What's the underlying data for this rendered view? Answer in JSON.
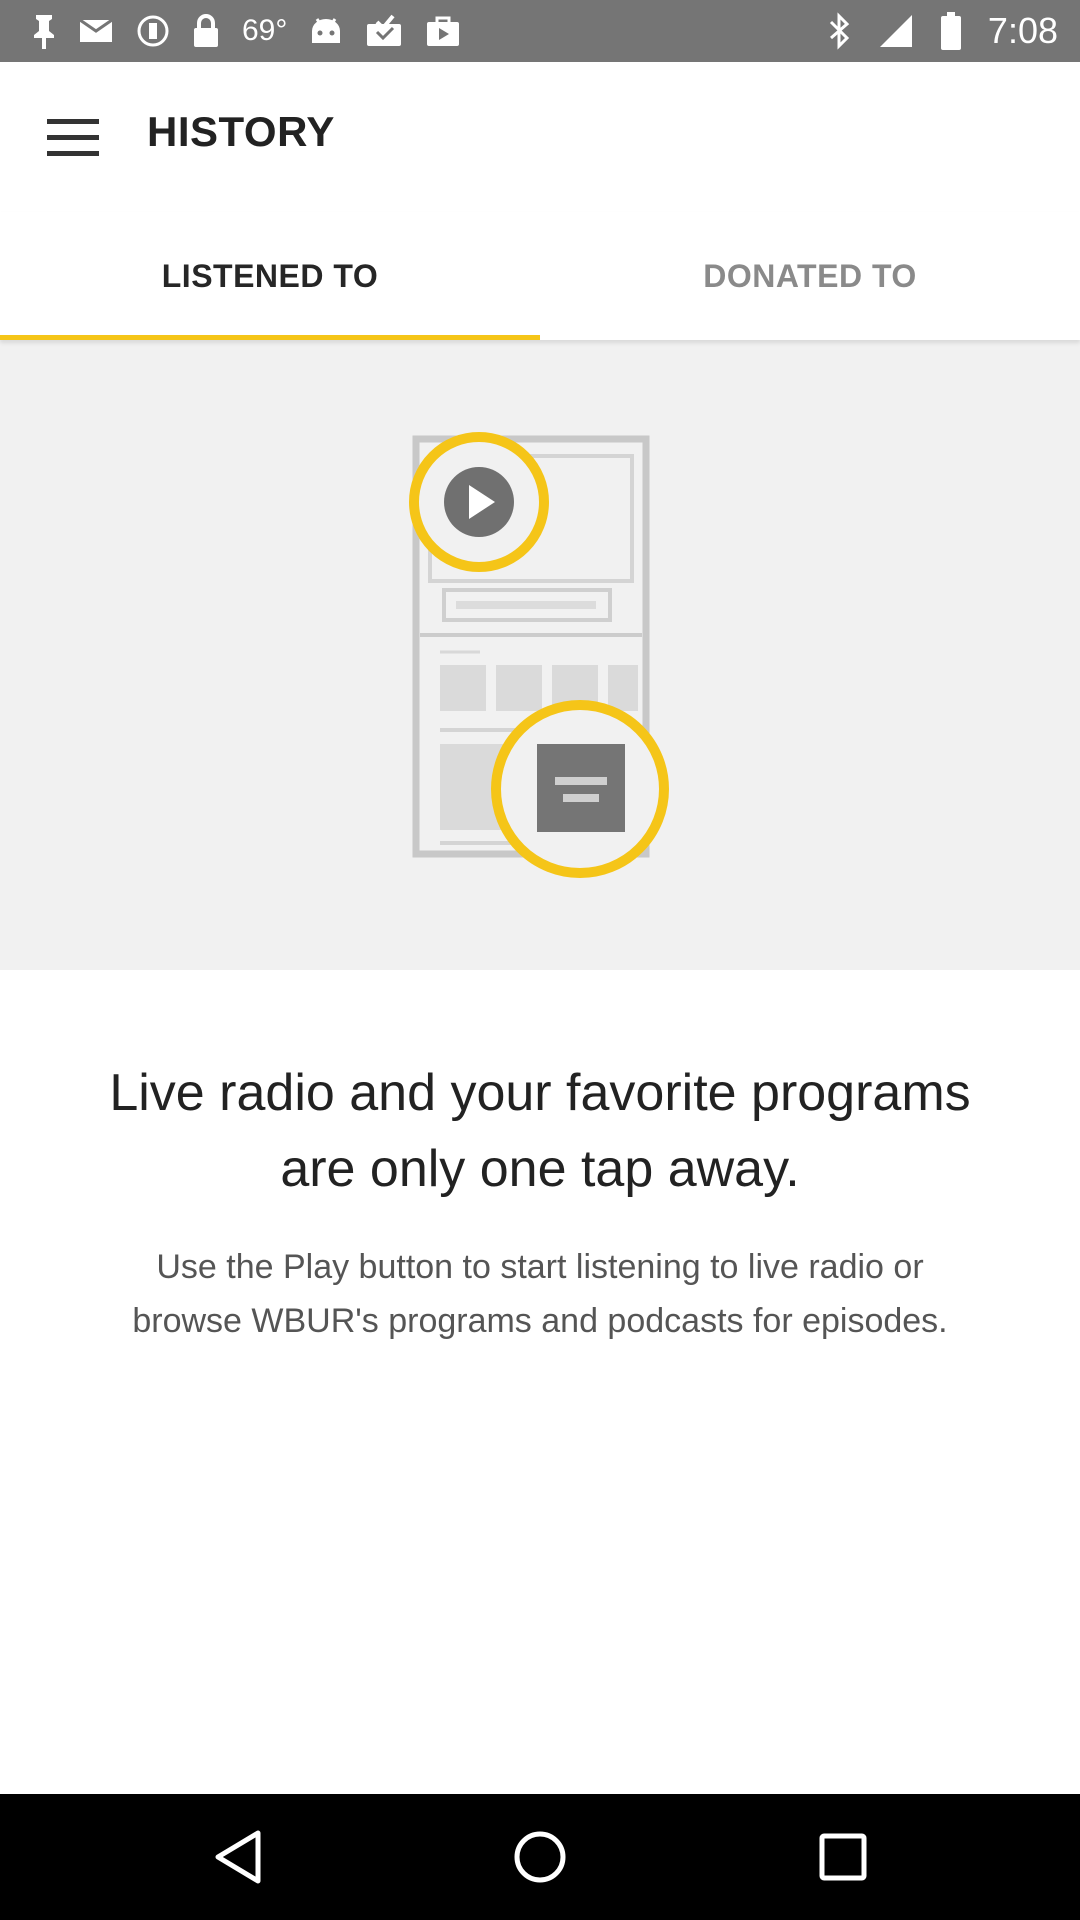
{
  "status_bar": {
    "temperature": "69°",
    "time": "7:08",
    "left_icons": [
      "pin-icon",
      "mail-icon",
      "do-not-disturb-icon",
      "lock-icon",
      "android-icon",
      "inbox-check-icon",
      "shopping-bag-icon"
    ],
    "right_icons": [
      "bluetooth-icon",
      "signal-icon",
      "battery-icon"
    ]
  },
  "header": {
    "title": "HISTORY",
    "menu_icon": "hamburger-menu-icon"
  },
  "tabs": [
    {
      "label": "LISTENED TO",
      "active": true
    },
    {
      "label": "DONATED TO",
      "active": false
    }
  ],
  "illustration": {
    "icons": [
      "phone-outline-icon",
      "play-icon",
      "stop-bar-icon"
    ]
  },
  "empty_state": {
    "headline_line1": "Live radio and your favorite programs",
    "headline_line2": "are only one tap away.",
    "description_line1": "Use the Play button to start listening to live radio or",
    "description_line2": "browse WBUR's programs and podcasts for episodes."
  },
  "nav_bar": {
    "buttons": [
      "back-icon",
      "home-icon",
      "recents-icon"
    ]
  },
  "colors": {
    "accent": "#F5C518",
    "status_bar": "#757575",
    "panel_bg": "#F1F1F1",
    "nav_bar": "#000000"
  }
}
